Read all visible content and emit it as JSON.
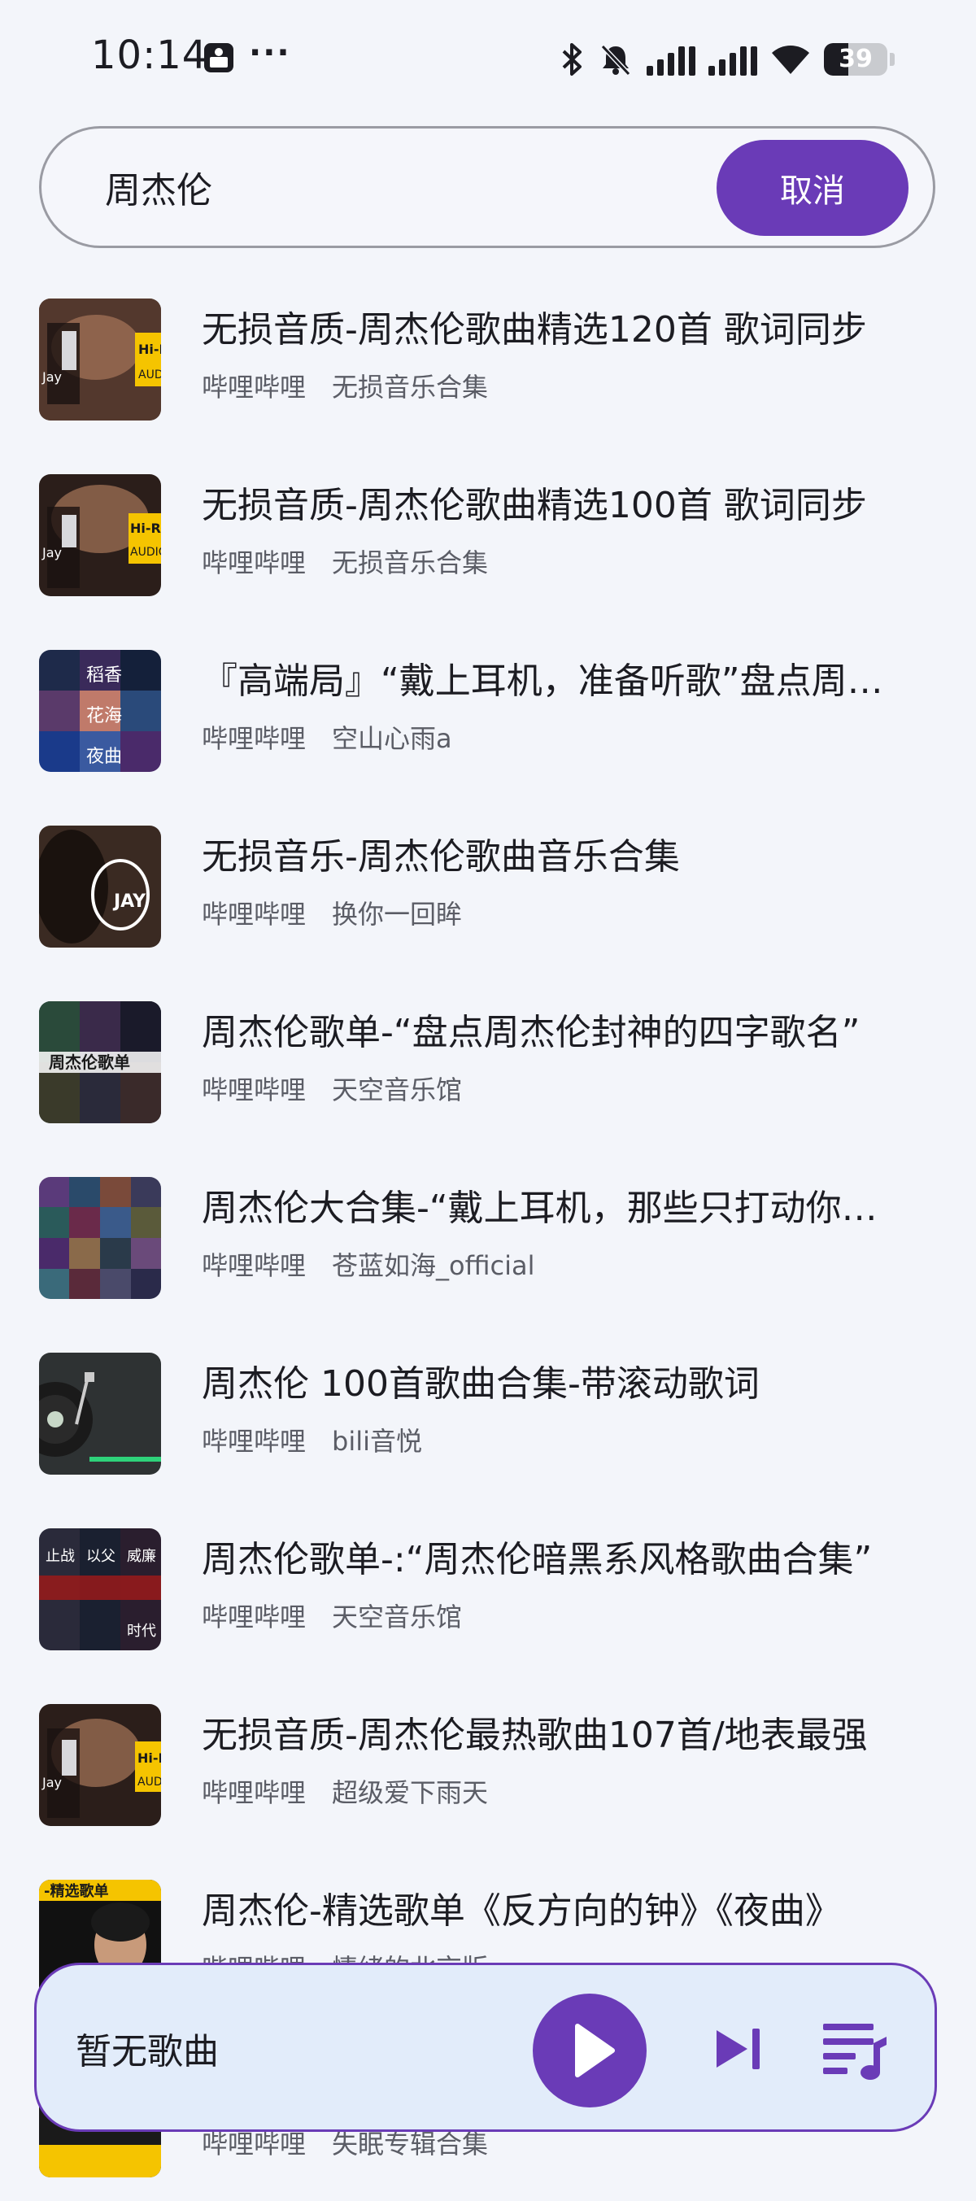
{
  "status_bar": {
    "time": "10:14",
    "more_indicator": "···",
    "battery_level": "39",
    "icons": [
      "app-notification-icon",
      "bluetooth-icon",
      "silent-bell-icon",
      "cellular-signal-icon",
      "cellular-signal-icon",
      "wifi-icon",
      "battery-icon"
    ]
  },
  "search": {
    "query": "周杰伦",
    "cancel_label": "取消"
  },
  "results": [
    {
      "title": "无损音质-周杰伦歌曲精选120首 歌词同步",
      "platform": "哔哩哔哩",
      "uploader": "无损音乐合集"
    },
    {
      "title": "无损音质-周杰伦歌曲精选100首 歌词同步",
      "platform": "哔哩哔哩",
      "uploader": "无损音乐合集"
    },
    {
      "title": "『高端局』“戴上耳机，准备听歌”盘点周杰伦",
      "platform": "哔哩哔哩",
      "uploader": "空山心雨a"
    },
    {
      "title": "无损音乐-周杰伦歌曲音乐合集",
      "platform": "哔哩哔哩",
      "uploader": "换你一回眸"
    },
    {
      "title": "周杰伦歌单-“盘点周杰伦封神的四字歌名”",
      "platform": "哔哩哔哩",
      "uploader": "天空音乐馆"
    },
    {
      "title": "周杰伦大合集-“戴上耳机，那些只打动你的歌”",
      "platform": "哔哩哔哩",
      "uploader": "苍蓝如海_official"
    },
    {
      "title": "周杰伦 100首歌曲合集-带滚动歌词",
      "platform": "哔哩哔哩",
      "uploader": "bili音悦"
    },
    {
      "title": "周杰伦歌单-:“周杰伦暗黑系风格歌曲合集”",
      "platform": "哔哩哔哩",
      "uploader": "天空音乐馆"
    },
    {
      "title": "无损音质-周杰伦最热歌曲107首/地表最强",
      "platform": "哔哩哔哩",
      "uploader": "超级爱下雨天"
    },
    {
      "title": "周杰伦-精选歌单《反方向的钟》《夜曲》",
      "platform": "哔哩哔哩",
      "uploader": "情绪的北京版"
    },
    {
      "title": "",
      "platform": "哔哩哔哩",
      "uploader": "失眠专辑合集"
    }
  ],
  "player": {
    "now_playing": "暂无歌曲",
    "accent_color": "#6a3bb7",
    "background_color": "#e2ecfa"
  },
  "colors": {
    "accent": "#6a3bb7",
    "page_background": "#f3f5fa"
  }
}
